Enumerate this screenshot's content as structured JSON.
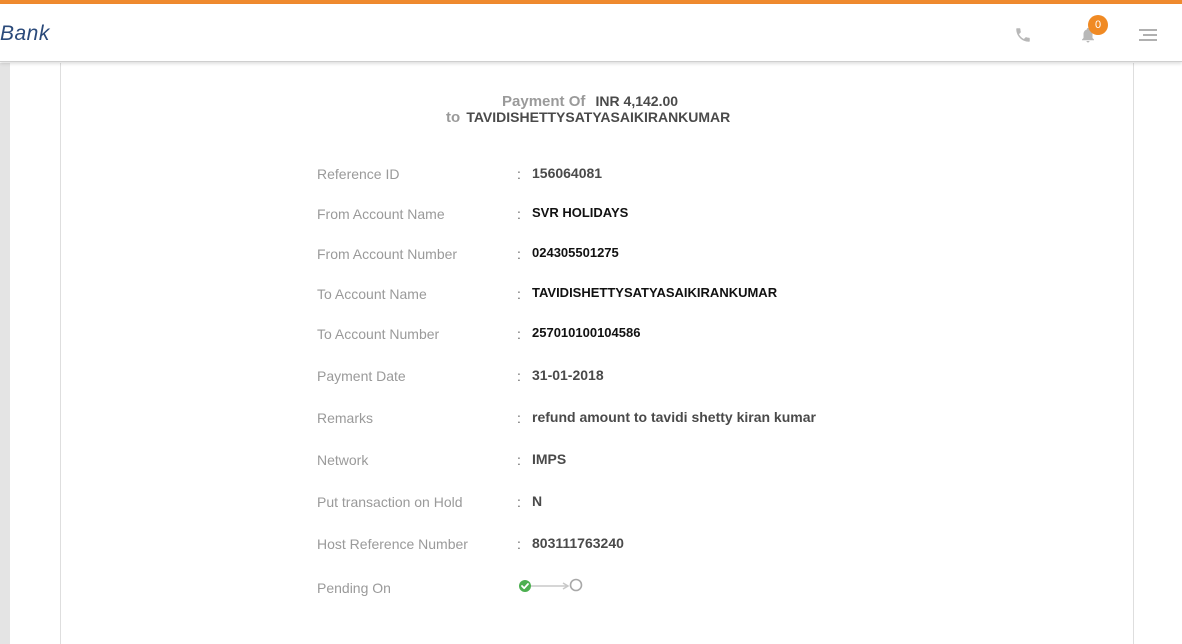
{
  "header": {
    "brand": "Bank",
    "icons": [
      "phone-icon",
      "bell-icon",
      "menu-icon"
    ],
    "notification_count": "0",
    "accent_color": "#ef8a2e"
  },
  "payment": {
    "heading_prefix": "Payment Of",
    "amount": "INR 4,142.00",
    "to_prefix": "to",
    "payee": "TAVIDISHETTYSATYASAIKIRANKUMAR"
  },
  "details": [
    {
      "label": "Reference ID",
      "value": "156064081"
    },
    {
      "label": "From Account Name",
      "value": "SVR HOLIDAYS"
    },
    {
      "label": "From Account Number",
      "value": "024305501275"
    },
    {
      "label": "To Account Name",
      "value": "TAVIDISHETTYSATYASAIKIRANKUMAR"
    },
    {
      "label": "To Account Number",
      "value": "257010100104586"
    },
    {
      "label": "Payment Date",
      "value": "31-01-2018"
    },
    {
      "label": "Remarks",
      "value": "refund amount to tavidi shetty kiran kumar"
    },
    {
      "label": "Network",
      "value": "IMPS"
    },
    {
      "label": "Put transaction on Hold",
      "value": "N"
    },
    {
      "label": "Host Reference Number",
      "value": "803111763240"
    },
    {
      "label": "Pending On",
      "value": ""
    }
  ],
  "separator": ":",
  "pending_steps": {
    "completed": 1,
    "total": 2,
    "done_color": "#4caf50"
  }
}
